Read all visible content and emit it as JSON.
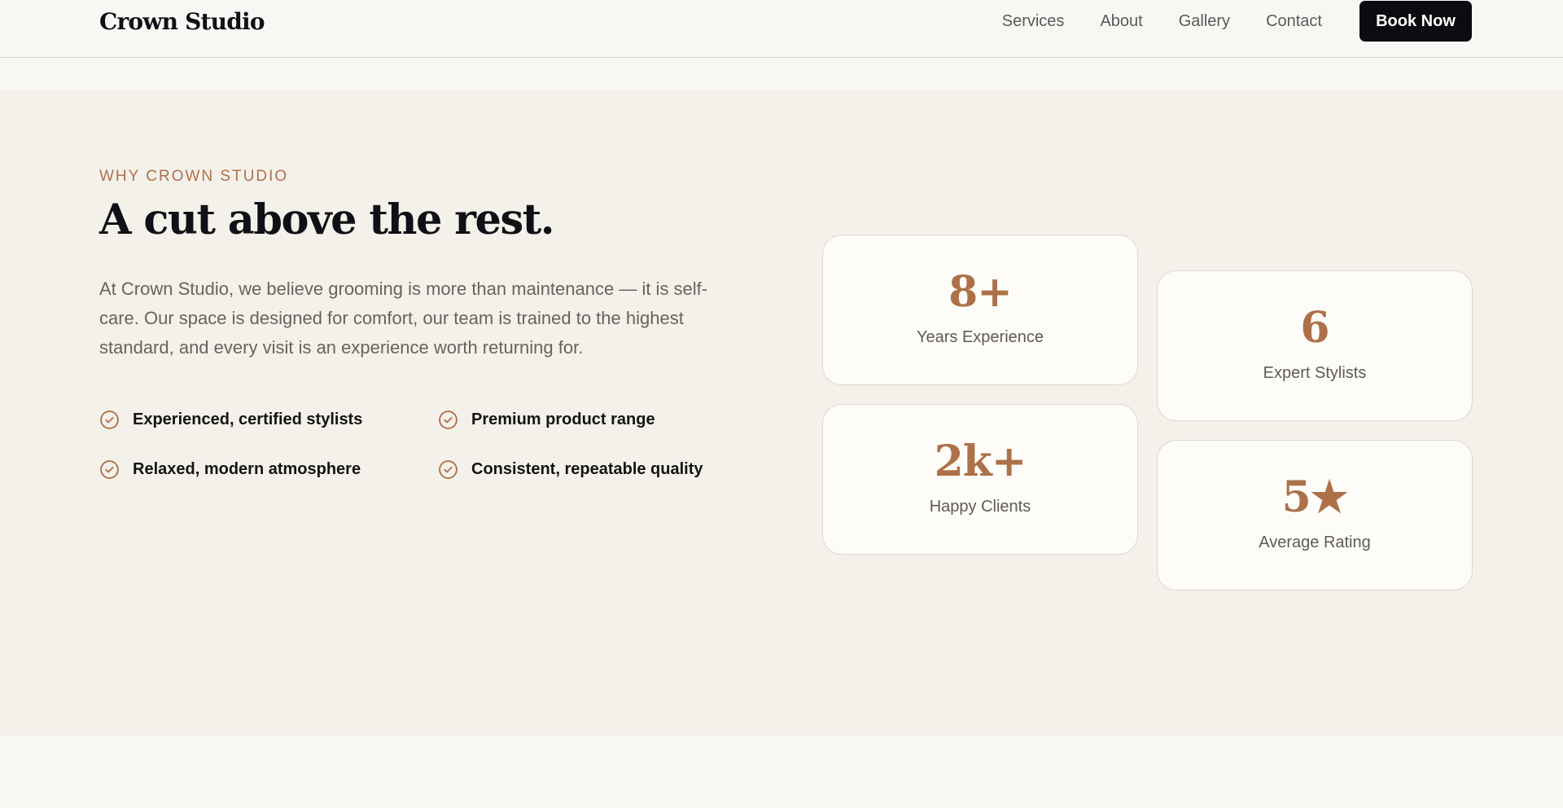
{
  "header": {
    "logo": "Crown Studio",
    "nav": [
      "Services",
      "About",
      "Gallery",
      "Contact"
    ],
    "cta": "Book Now"
  },
  "section": {
    "eyebrow": "WHY CROWN STUDIO",
    "headline": "A cut above the rest.",
    "body": "At Crown Studio, we believe grooming is more than maintenance — it is self-care. Our space is designed for comfort, our team is trained to the highest standard, and every visit is an experience worth returning for.",
    "features": [
      "Experienced, certified stylists",
      "Premium product range",
      "Relaxed, modern atmosphere",
      "Consistent, repeatable quality"
    ],
    "stats": [
      {
        "value": "8+",
        "label": "Years Experience"
      },
      {
        "value": "6",
        "label": "Expert Stylists"
      },
      {
        "value": "2k+",
        "label": "Happy Clients"
      },
      {
        "value": "5★",
        "label": "Average Rating"
      }
    ]
  },
  "colors": {
    "accent": "#ad7149",
    "dark": "#0f1117",
    "section_bg": "#f4f1eb",
    "page_bg": "#f8f7f4"
  },
  "icons": {
    "feature_check": "check-circle-icon"
  }
}
